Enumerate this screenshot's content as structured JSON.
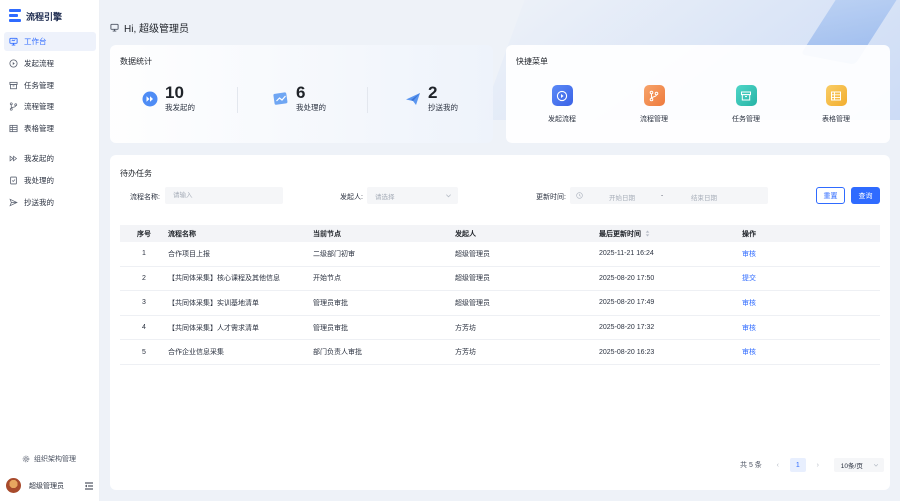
{
  "app": {
    "name": "流程引擎"
  },
  "nav": {
    "items": [
      {
        "label": "工作台",
        "icon": "workbench-icon",
        "active": true
      },
      {
        "label": "发起流程",
        "icon": "play-circle-icon"
      },
      {
        "label": "任务管理",
        "icon": "archive-icon"
      },
      {
        "label": "流程管理",
        "icon": "git-branch-icon"
      },
      {
        "label": "表格管理",
        "icon": "table-icon"
      }
    ],
    "items2": [
      {
        "label": "我发起的",
        "icon": "fast-forward-icon"
      },
      {
        "label": "我处理的",
        "icon": "checklist-icon"
      },
      {
        "label": "抄送我的",
        "icon": "send-icon"
      }
    ],
    "org_link": "组织架构管理",
    "user_name": "超级管理员"
  },
  "greeting": "Hi, 超级管理员",
  "stats": {
    "title": "数据统计",
    "items": [
      {
        "value": "10",
        "label": "我发起的"
      },
      {
        "value": "6",
        "label": "我处理的"
      },
      {
        "value": "2",
        "label": "抄送我的"
      }
    ]
  },
  "quick_menu": {
    "title": "快捷菜单",
    "items": [
      {
        "label": "发起流程",
        "color": "#3d6df2"
      },
      {
        "label": "流程管理",
        "color": "#f08a4b"
      },
      {
        "label": "任务管理",
        "color": "#35c3b5"
      },
      {
        "label": "表格管理",
        "color": "#f5b942"
      }
    ]
  },
  "tasks": {
    "title": "待办任务",
    "filters": {
      "name_label": "流程名称:",
      "name_placeholder": "请输入",
      "initiator_label": "发起人:",
      "initiator_placeholder": "请选择",
      "time_label": "更新时间:",
      "start_placeholder": "开始日期",
      "range_sep": "-",
      "end_placeholder": "结束日期",
      "reset": "重置",
      "query": "查询"
    },
    "columns": [
      "序号",
      "流程名称",
      "当前节点",
      "发起人",
      "最后更新时间",
      "操作"
    ],
    "rows": [
      {
        "no": "1",
        "name": "合作项目上报",
        "node": "二级部门初审",
        "initiator": "超级管理员",
        "time": "2025-11-21 16:24",
        "op": "审核"
      },
      {
        "no": "2",
        "name": "【共同体采集】核心课程及其他信息",
        "node": "开始节点",
        "initiator": "超级管理员",
        "time": "2025-08-20 17:50",
        "op": "提交"
      },
      {
        "no": "3",
        "name": "【共同体采集】实训基地清单",
        "node": "管理员审批",
        "initiator": "超级管理员",
        "time": "2025-08-20 17:49",
        "op": "审核"
      },
      {
        "no": "4",
        "name": "【共同体采集】人才需求清单",
        "node": "管理员审批",
        "initiator": "方芳坊",
        "time": "2025-08-20 17:32",
        "op": "审核"
      },
      {
        "no": "5",
        "name": "合作企业信息采集",
        "node": "部门负责人审批",
        "initiator": "方芳坊",
        "time": "2025-08-20 16:23",
        "op": "审核"
      }
    ],
    "pagination": {
      "total": "共 5 条",
      "page": "1",
      "page_size": "10条/页"
    }
  }
}
